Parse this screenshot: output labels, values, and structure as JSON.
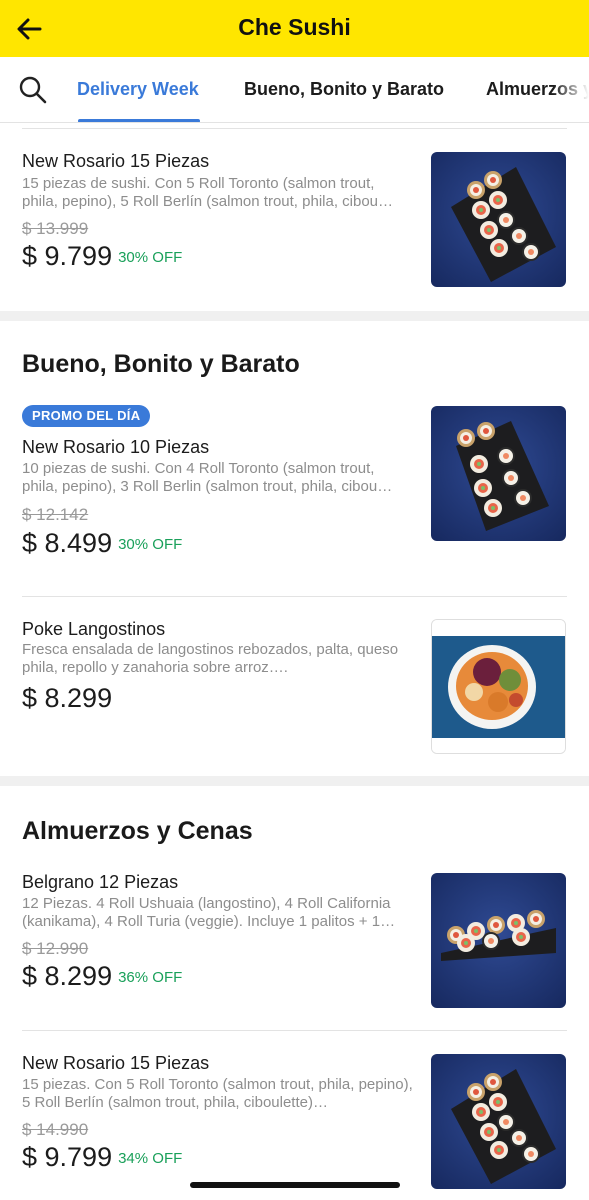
{
  "header": {
    "title": "Che Sushi"
  },
  "tabs": [
    {
      "label": "Delivery Week"
    },
    {
      "label": "Bueno, Bonito y Barato"
    },
    {
      "label": "Almuerzos y Cenas"
    }
  ],
  "sections": [
    {
      "title": "",
      "items": [
        {
          "name": "New Rosario 15 Piezas",
          "description": "15 piezas de sushi. Con 5 Roll Toronto (salmon trout, phila, pepino), 5 Roll Berlín (salmon trout, phila, cibou…",
          "old_price": "$ 13.999",
          "price": "$ 9.799",
          "discount": "30% OFF",
          "image": "sushi-platter-15"
        }
      ]
    },
    {
      "title": "Bueno, Bonito y Barato",
      "items": [
        {
          "badge": "PROMO DEL DÍA",
          "name": "New Rosario 10 Piezas",
          "description": "10 piezas de sushi. Con 4 Roll Toronto (salmon trout, phila, pepino), 3 Roll Berlin (salmon trout, phila, cibou…",
          "old_price": "$ 12.142",
          "price": "$ 8.499",
          "discount": "30% OFF",
          "image": "sushi-platter-10"
        },
        {
          "name": "Poke Langostinos",
          "description": "Fresca ensalada de langostinos rebozados, palta, queso phila, repollo y zanahoria sobre arroz….",
          "price": "$ 8.299",
          "image": "poke-bowl"
        }
      ]
    },
    {
      "title": "Almuerzos y Cenas",
      "items": [
        {
          "name": "Belgrano 12 Piezas",
          "description": "12 Piezas. 4 Roll Ushuaia (langostino), 4 Roll California (kanikama), 4 Roll Turia (veggie). Incluye 1 palitos + 1…",
          "old_price": "$ 12.990",
          "price": "$ 8.299",
          "discount": "36% OFF",
          "image": "sushi-rolls-12"
        },
        {
          "name": "New Rosario 15 Piezas",
          "description": "15 piezas. Con 5 Roll Toronto (salmon trout, phila, pepino), 5 Roll Berlín (salmon trout, phila, ciboulette)…",
          "old_price": "$ 14.990",
          "price": "$ 9.799",
          "discount": "34% OFF",
          "image": "sushi-platter-15"
        }
      ]
    }
  ],
  "colors": {
    "header_bg": "#ffe600",
    "accent": "#3a7ad9",
    "discount": "#1aa05a"
  },
  "icons": [
    "back-arrow-icon",
    "search-icon"
  ]
}
